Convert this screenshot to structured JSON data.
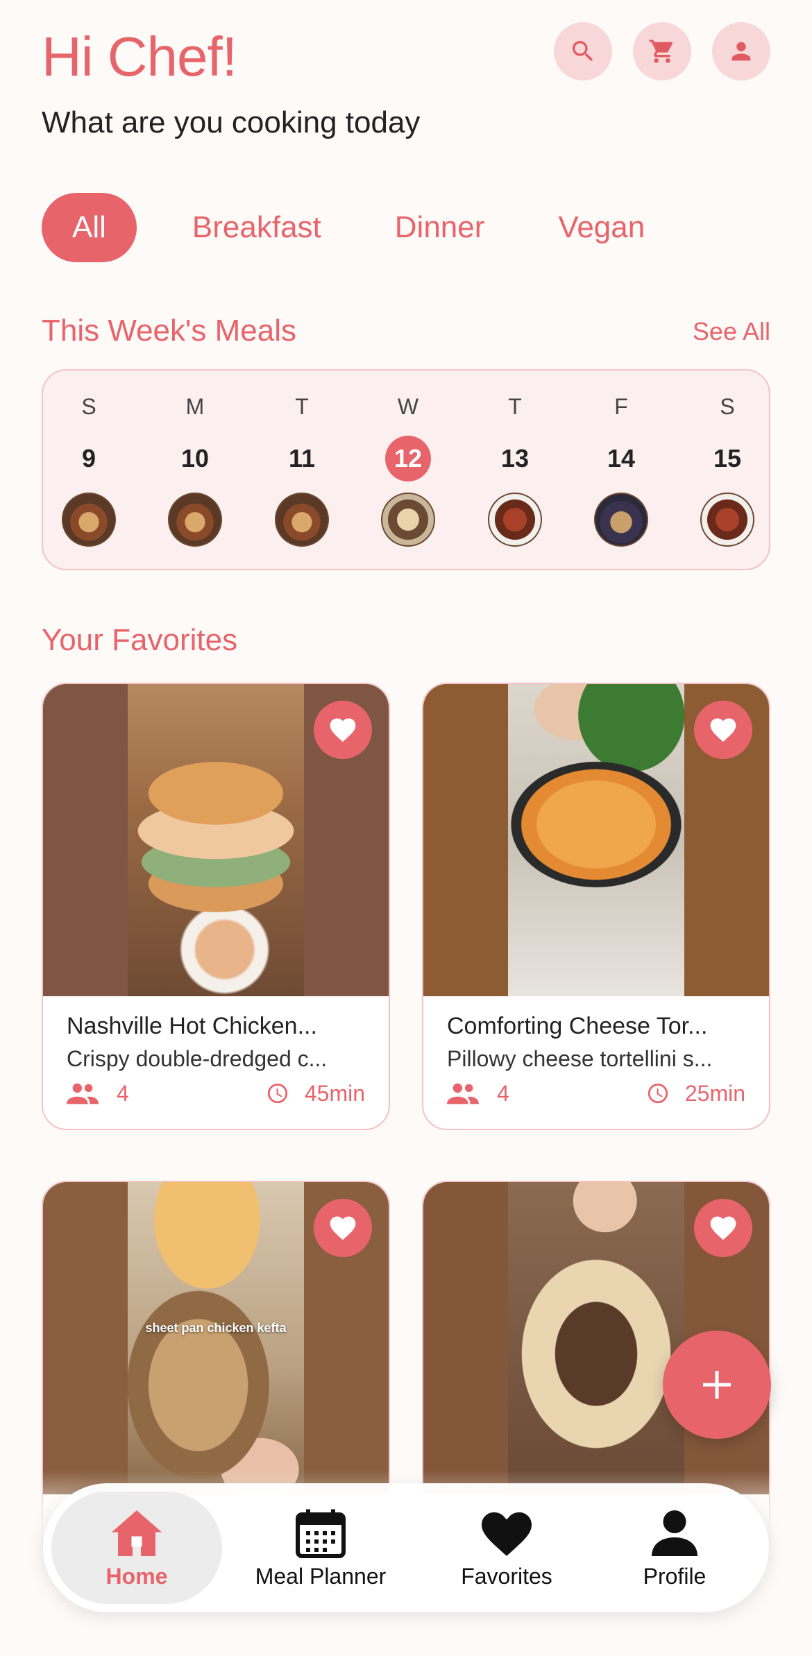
{
  "header": {
    "greeting": "Hi Chef!",
    "subtitle": "What are you cooking today",
    "actions": [
      "search-icon",
      "cart-icon",
      "profile-icon"
    ]
  },
  "categories": [
    {
      "label": "All",
      "active": true
    },
    {
      "label": "Breakfast",
      "active": false
    },
    {
      "label": "Dinner",
      "active": false
    },
    {
      "label": "Vegan",
      "active": false
    }
  ],
  "week": {
    "title": "This Week's Meals",
    "see_all": "See All",
    "days": [
      {
        "dow": "S",
        "date": "9",
        "today": false
      },
      {
        "dow": "M",
        "date": "10",
        "today": false
      },
      {
        "dow": "T",
        "date": "11",
        "today": false
      },
      {
        "dow": "W",
        "date": "12",
        "today": true
      },
      {
        "dow": "T",
        "date": "13",
        "today": false
      },
      {
        "dow": "F",
        "date": "14",
        "today": false
      },
      {
        "dow": "S",
        "date": "15",
        "today": false
      }
    ]
  },
  "favorites": {
    "title": "Your Favorites",
    "cards": [
      {
        "title": "Nashville Hot Chicken...",
        "desc": "Crispy double-dredged c...",
        "servings": "4",
        "time": "45min"
      },
      {
        "title": "Comforting Cheese Tor...",
        "desc": "Pillowy cheese tortellini s...",
        "servings": "4",
        "time": "25min"
      },
      {
        "title": "",
        "desc": "",
        "servings": "",
        "time": "",
        "overlay_text": "sheet pan chicken kefta"
      },
      {
        "title": "",
        "desc": "",
        "servings": "",
        "time": ""
      }
    ]
  },
  "nav": {
    "items": [
      {
        "label": "Home",
        "icon": "home-icon",
        "active": true
      },
      {
        "label": "Meal Planner",
        "icon": "calendar-icon",
        "active": false
      },
      {
        "label": "Favorites",
        "icon": "heart-icon",
        "active": false
      },
      {
        "label": "Profile",
        "icon": "person-icon",
        "active": false
      }
    ]
  },
  "colors": {
    "accent": "#e8646b",
    "accent_soft": "#f8d7d8",
    "background": "#fdfaf8"
  }
}
